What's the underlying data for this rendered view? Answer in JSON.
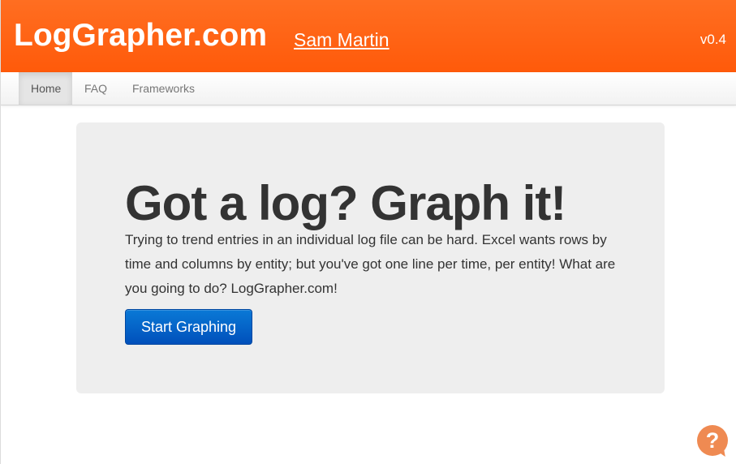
{
  "header": {
    "brand": "LogGrapher.com",
    "author": "Sam Martin",
    "version": "v0.4",
    "background_color": "#ff5a0a"
  },
  "nav": {
    "items": [
      {
        "label": "Home",
        "active": true
      },
      {
        "label": "FAQ",
        "active": false
      },
      {
        "label": "Frameworks",
        "active": false
      }
    ]
  },
  "hero": {
    "title": "Got a log? Graph it!",
    "text": "Trying to trend entries in an individual log file can be hard. Excel wants rows by time and columns by entity; but you've got one line per time, per entity! What are you going to do? LogGrapher.com!",
    "button_label": "Start Graphing",
    "button_color": "#0050bb"
  },
  "help": {
    "icon": "question-bubble-icon",
    "glyph": "?",
    "color": "#ef8a52"
  }
}
